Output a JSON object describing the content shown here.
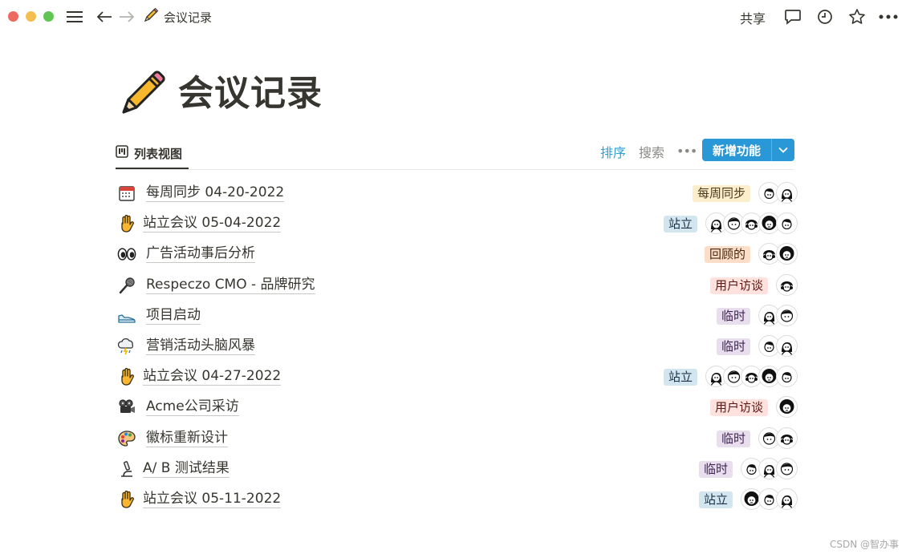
{
  "topbar": {
    "breadcrumb_title": "会议记录",
    "share_label": "共享",
    "traffic_colors": [
      "#ed6a5e",
      "#f4bf4f",
      "#61c554"
    ]
  },
  "page": {
    "title": "会议记录",
    "icon": "pencil-icon"
  },
  "toolbar": {
    "view_tab_label": "列表视图",
    "sort_label": "排序",
    "search_label": "搜索",
    "more_label": "•••",
    "new_label": "新增功能",
    "accent": "#2a97d6"
  },
  "rows": [
    {
      "icon": "calendar-icon",
      "title": "每周同步 04-20-2022",
      "tag": "每周同步",
      "tag_color": "yellow",
      "avatars": 2
    },
    {
      "icon": "raised-hand-icon",
      "title": "站立会议 05-04-2022",
      "tag": "站立",
      "tag_color": "blue",
      "avatars": 5
    },
    {
      "icon": "eyes-icon",
      "title": "广告活动事后分析",
      "tag": "回顾的",
      "tag_color": "orange",
      "avatars": 2
    },
    {
      "icon": "microphone-icon",
      "title": "Respeczo CMO - 品牌研究",
      "tag": "用户访谈",
      "tag_color": "red",
      "avatars": 1
    },
    {
      "icon": "sneaker-icon",
      "title": "项目启动",
      "tag": "临时",
      "tag_color": "purple",
      "avatars": 2
    },
    {
      "icon": "storm-cloud-icon",
      "title": "营销活动头脑风暴",
      "tag": "临时",
      "tag_color": "purple",
      "avatars": 2
    },
    {
      "icon": "raised-hand-icon",
      "title": "站立会议 04-27-2022",
      "tag": "站立",
      "tag_color": "blue",
      "avatars": 5
    },
    {
      "icon": "film-projector-icon",
      "title": "Acme公司采访",
      "tag": "用户访谈",
      "tag_color": "red",
      "avatars": 1
    },
    {
      "icon": "palette-icon",
      "title": "徽标重新设计",
      "tag": "临时",
      "tag_color": "purple",
      "avatars": 2
    },
    {
      "icon": "microscope-icon",
      "title": "A/ B 测试结果",
      "tag": "临时",
      "tag_color": "purple",
      "avatars": 3
    },
    {
      "icon": "raised-hand-icon",
      "title": "站立会议 05-11-2022",
      "tag": "站立",
      "tag_color": "blue",
      "avatars": 3
    }
  ],
  "tag_colors": {
    "yellow": {
      "bg": "#fbeecb",
      "fg": "#4a3b1f"
    },
    "blue": {
      "bg": "#d3e5ef",
      "fg": "#183347"
    },
    "orange": {
      "bg": "#fadec9",
      "fg": "#49290e"
    },
    "red": {
      "bg": "#ffe2dd",
      "fg": "#5d1715"
    },
    "purple": {
      "bg": "#e8deee",
      "fg": "#412454"
    }
  },
  "watermark": "CSDN @智办事"
}
